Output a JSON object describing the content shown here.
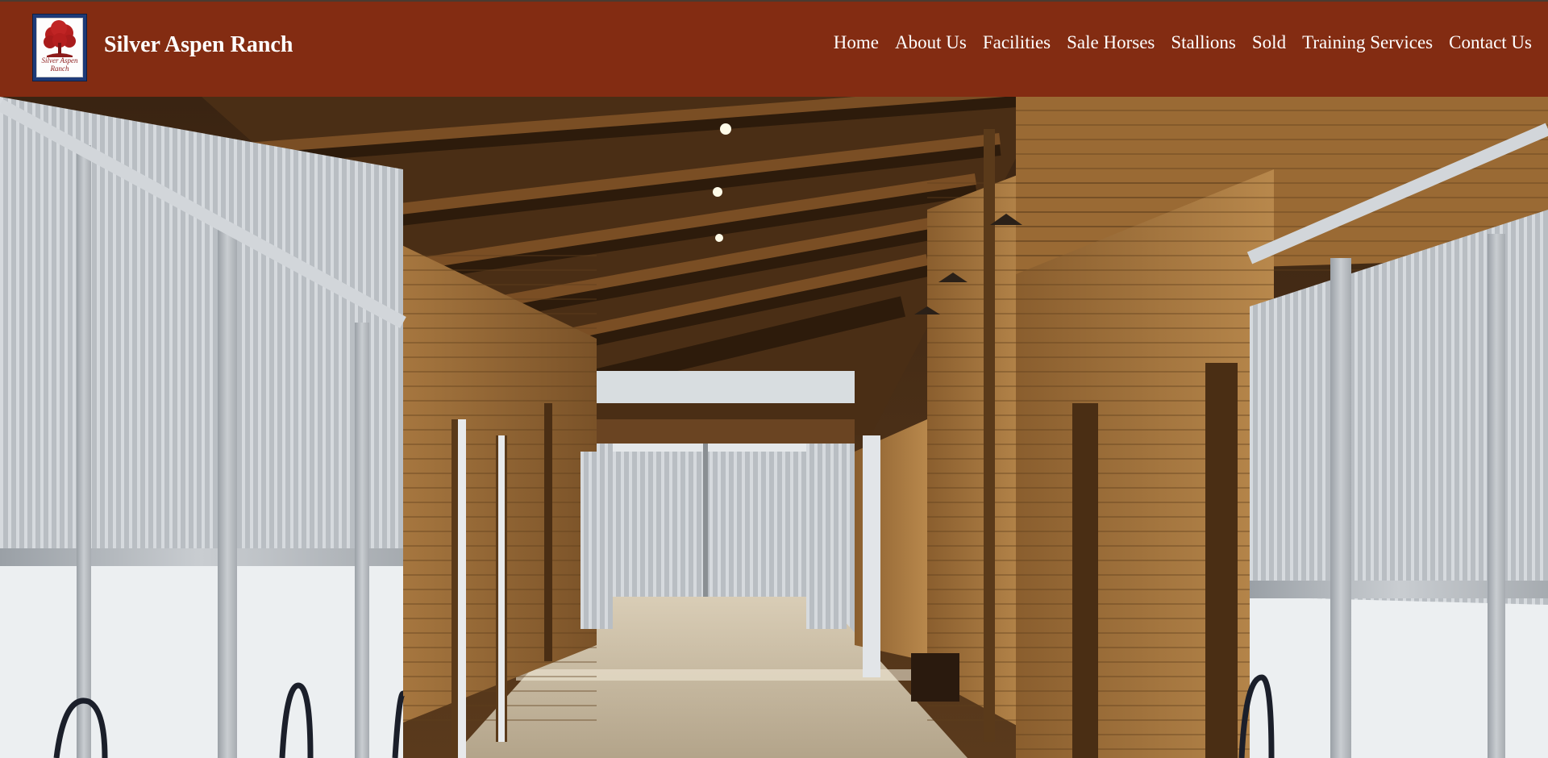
{
  "site": {
    "name": "Silver Aspen Ranch",
    "logo_text_line1": "Silver Aspen",
    "logo_text_line2": "Ranch"
  },
  "nav": {
    "items": [
      {
        "label": "Home"
      },
      {
        "label": "About Us"
      },
      {
        "label": "Facilities"
      },
      {
        "label": "Sale Horses"
      },
      {
        "label": "Stallions"
      },
      {
        "label": "Sold"
      },
      {
        "label": "Training Services"
      },
      {
        "label": "Contact Us"
      }
    ]
  },
  "colors": {
    "header_bg": "#832c12",
    "logo_bg": "#1d3a78",
    "logo_tree": "#b51e1e",
    "nav_text": "#ffffff"
  },
  "hero": {
    "image": "barn-aisle-photo"
  }
}
